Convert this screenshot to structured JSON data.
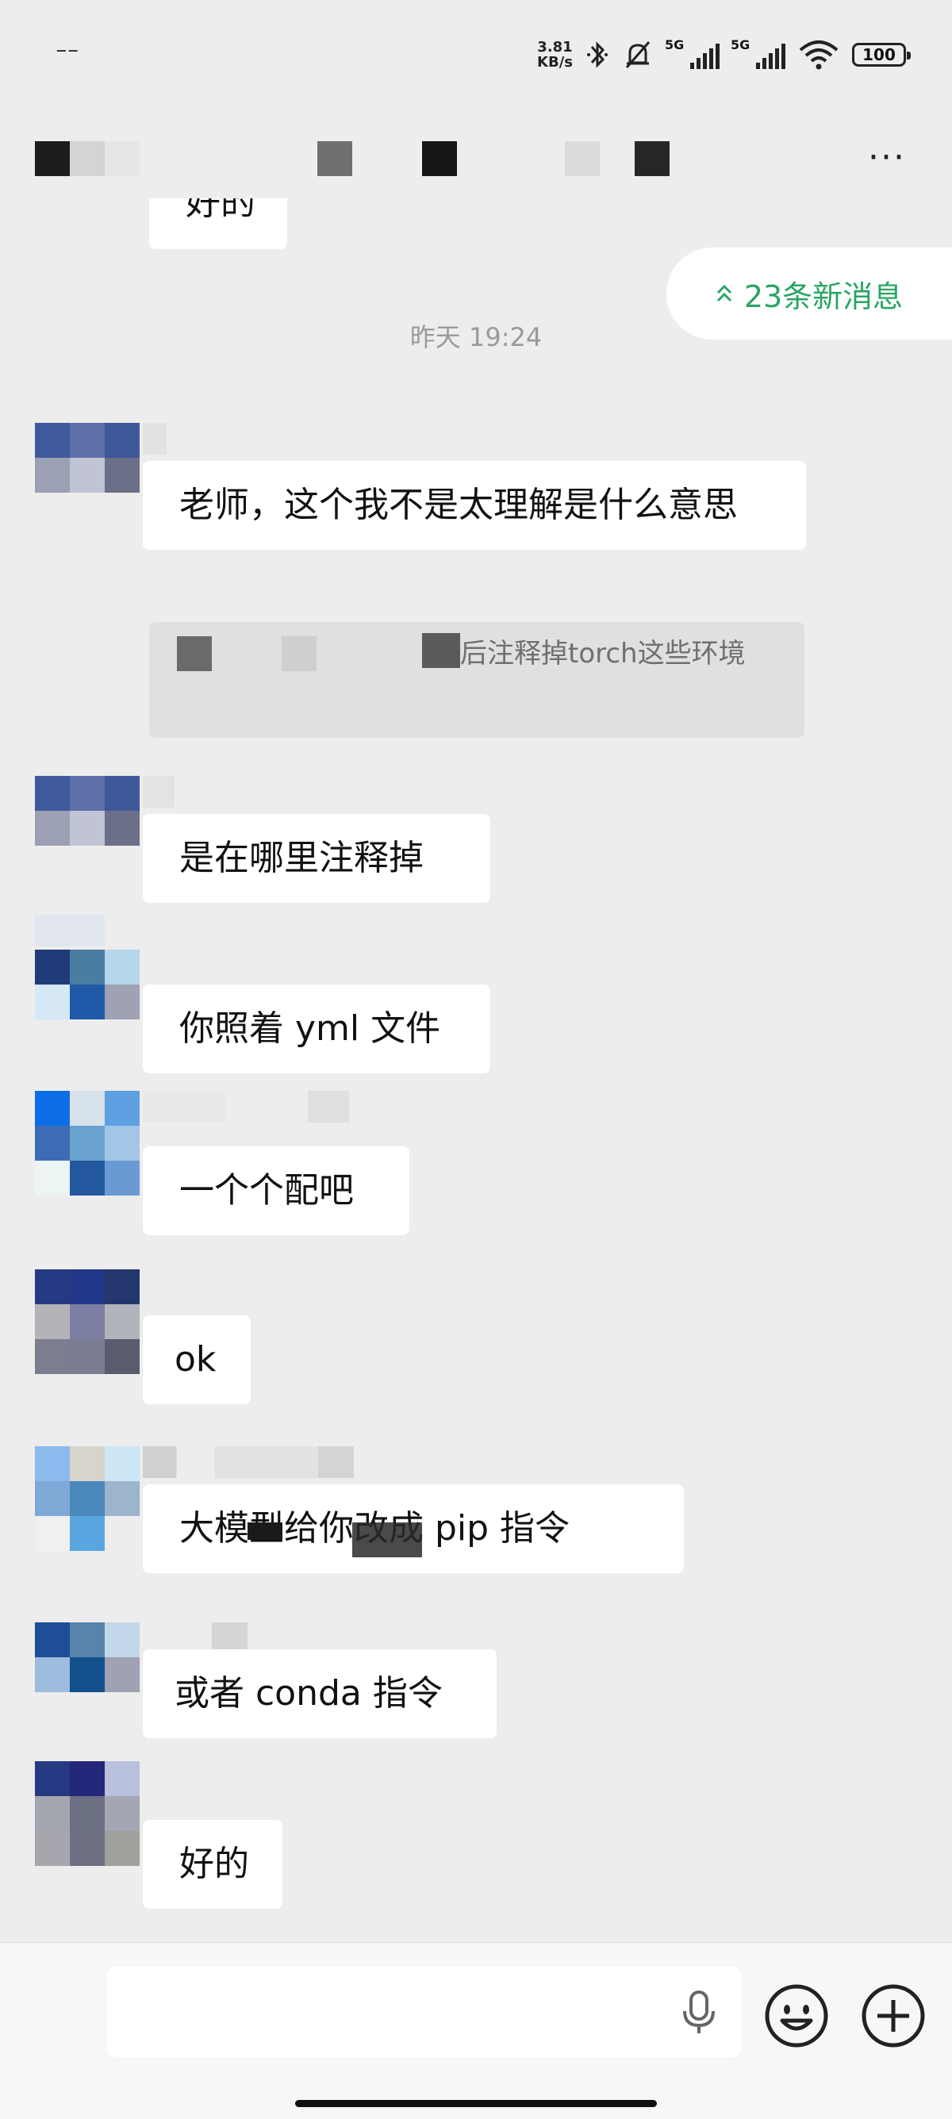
{
  "status_bar": {
    "left": "⁻⁻",
    "net_speed_value": "3.81",
    "net_speed_unit": "KB/s",
    "sim1": "5G",
    "sim2": "5G",
    "battery": "100"
  },
  "header": {
    "more_icon": "more-icon"
  },
  "chat": {
    "top_partial_bubble": "好的",
    "new_messages_badge": "23条新消息",
    "timestamp": "昨天 19:24",
    "messages": [
      {
        "text": "老师，这个我不是太理解是什么意思"
      },
      {
        "quote": "然后注释掉torch这些环境"
      },
      {
        "text": "是在哪里注释掉"
      },
      {
        "text": "你照着 yml 文件"
      },
      {
        "text": "一个个配吧"
      },
      {
        "text": "ok"
      },
      {
        "text": "大模型给你改成 pip 指令"
      },
      {
        "text": "或者 conda 指令"
      },
      {
        "text": "好的"
      }
    ]
  },
  "input_bar": {
    "mic_icon": "microphone-icon",
    "emoji_icon": "emoji-icon",
    "plus_icon": "plus-icon"
  },
  "colors": {
    "background": "#ededed",
    "accent_green": "#2aa564",
    "bubble": "#ffffff"
  }
}
